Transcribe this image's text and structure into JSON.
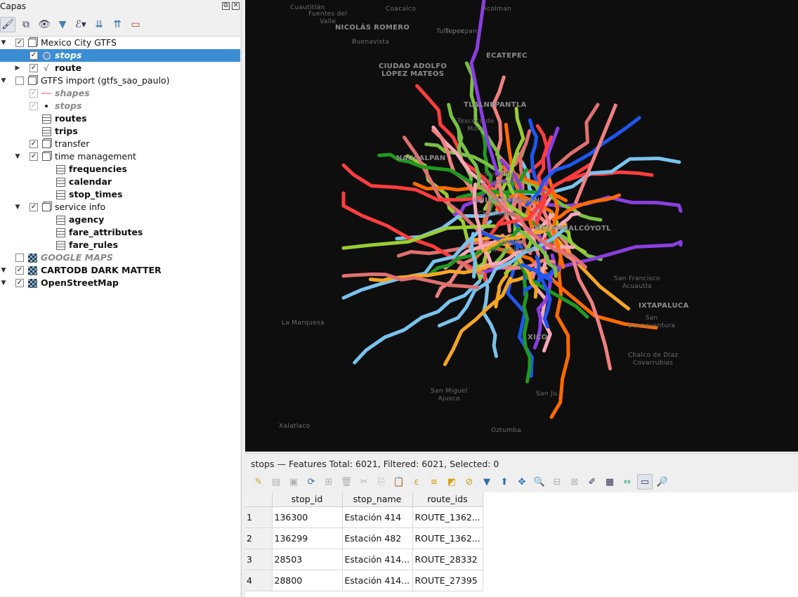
{
  "layers_panel": {
    "title": "Capas",
    "float_btn": "⧉",
    "close_btn": "✕",
    "tree": [
      {
        "label": "Mexico City GTFS",
        "level": 0,
        "arrow": "▼",
        "checked": true,
        "icon": "group",
        "style": ""
      },
      {
        "label": "stops",
        "level": 1,
        "arrow": "",
        "checked": true,
        "icon": "point",
        "style": "bold ital",
        "selected": true
      },
      {
        "label": "route",
        "level": 1,
        "arrow": "▶",
        "checked": true,
        "icon": "line",
        "style": "bold"
      },
      {
        "label": "GTFS import (gtfs_sao_paulo)",
        "level": 0,
        "arrow": "▼",
        "checked": false,
        "icon": "group",
        "style": ""
      },
      {
        "label": "shapes",
        "level": 1,
        "arrow": "",
        "checked": true,
        "dim": true,
        "icon": "pinkline",
        "style": "bold ital gray"
      },
      {
        "label": "stops",
        "level": 1,
        "arrow": "",
        "checked": true,
        "dim": true,
        "icon": "dot",
        "style": "bold ital gray"
      },
      {
        "label": "routes",
        "level": 1,
        "arrow": "",
        "icon": "table",
        "style": "bold"
      },
      {
        "label": "trips",
        "level": 1,
        "arrow": "",
        "icon": "table",
        "style": "bold"
      },
      {
        "label": "transfer",
        "level": 1,
        "arrow": "",
        "checked": true,
        "icon": "group",
        "style": ""
      },
      {
        "label": "time management",
        "level": 1,
        "arrow": "▼",
        "checked": true,
        "icon": "group",
        "style": ""
      },
      {
        "label": "frequencies",
        "level": 2,
        "arrow": "",
        "icon": "table",
        "style": "bold"
      },
      {
        "label": "calendar",
        "level": 2,
        "arrow": "",
        "icon": "table",
        "style": "bold"
      },
      {
        "label": "stop_times",
        "level": 2,
        "arrow": "",
        "icon": "table",
        "style": "bold"
      },
      {
        "label": "service info",
        "level": 1,
        "arrow": "▼",
        "checked": true,
        "icon": "group",
        "style": ""
      },
      {
        "label": "agency",
        "level": 2,
        "arrow": "",
        "icon": "table",
        "style": "bold"
      },
      {
        "label": "fare_attributes",
        "level": 2,
        "arrow": "",
        "icon": "table",
        "style": "bold"
      },
      {
        "label": "fare_rules",
        "level": 2,
        "arrow": "",
        "icon": "table",
        "style": "bold"
      },
      {
        "label": "GOOGLE MAPS",
        "level": 0,
        "arrow": "",
        "checked": false,
        "icon": "tile",
        "style": "bold ital gray"
      },
      {
        "label": "CARTODB DARK MATTER",
        "level": 0,
        "arrow": "▼",
        "checked": true,
        "icon": "tile",
        "style": "bold"
      },
      {
        "label": "OpenStreetMap",
        "level": 0,
        "arrow": "▼",
        "checked": true,
        "icon": "tile",
        "style": "bold"
      }
    ]
  },
  "map": {
    "places": [
      {
        "name": "Cuautitlán",
        "cls": "sm"
      },
      {
        "name": "Coacalco",
        "cls": "sm"
      },
      {
        "name": "Acolman",
        "cls": "sm"
      },
      {
        "name": "Tultepec",
        "cls": "sm"
      },
      {
        "name": "Fuentes del\nValle",
        "cls": "sm"
      },
      {
        "name": "NICOLÁS ROMERO",
        "cls": ""
      },
      {
        "name": "Buenavista",
        "cls": "sm"
      },
      {
        "name": "Tepexpan",
        "cls": "sm"
      },
      {
        "name": "CIUDAD ADOLFO\nLÓPEZ MATEOS",
        "cls": ""
      },
      {
        "name": "ECATEPEC",
        "cls": ""
      },
      {
        "name": "TLALNEPANTLA",
        "cls": ""
      },
      {
        "name": "Texcoco de\nMora",
        "cls": "sm"
      },
      {
        "name": "NAUCALPAN",
        "cls": ""
      },
      {
        "name": "San Miguel\nCoatlinchán",
        "cls": "sm"
      },
      {
        "name": "CHIMALHUACÁN",
        "cls": ""
      },
      {
        "name": "Chicoloapan",
        "cls": "sm"
      },
      {
        "name": "Santiago\nYancuitlalpan",
        "cls": "sm"
      },
      {
        "name": "NEZAHUALCÓYOTL",
        "cls": ""
      },
      {
        "name": "San Francisco\nAcuautla",
        "cls": "sm"
      },
      {
        "name": "IXTAPALUCA",
        "cls": ""
      },
      {
        "name": "La Marquesa",
        "cls": "sm"
      },
      {
        "name": "San\nBuenaventura",
        "cls": "sm"
      },
      {
        "name": "XICO",
        "cls": ""
      },
      {
        "name": "Chalco de Díaz\nCovarrubias",
        "cls": "sm"
      },
      {
        "name": "San Miguel\nAjusco",
        "cls": "sm"
      },
      {
        "name": "San Ju…",
        "cls": "sm"
      },
      {
        "name": "Xalatlaco",
        "cls": "sm"
      },
      {
        "name": "Oztumba",
        "cls": "sm"
      }
    ]
  },
  "attribute_table": {
    "title": "stops — Features Total: 6021, Filtered: 6021, Selected: 0",
    "columns": [
      "stop_id",
      "stop_name",
      "route_ids"
    ],
    "rows": [
      {
        "n": "1",
        "stop_id": "136300",
        "stop_name": "Estación 414",
        "route_ids": "ROUTE_1362..."
      },
      {
        "n": "2",
        "stop_id": "136299",
        "stop_name": "Estación 482",
        "route_ids": "ROUTE_1362..."
      },
      {
        "n": "3",
        "stop_id": "28503",
        "stop_name": "Estación 414...",
        "route_ids": "ROUTE_28332"
      },
      {
        "n": "4",
        "stop_id": "28800",
        "stop_name": "Estación 414...",
        "route_ids": "ROUTE_27395"
      }
    ]
  }
}
